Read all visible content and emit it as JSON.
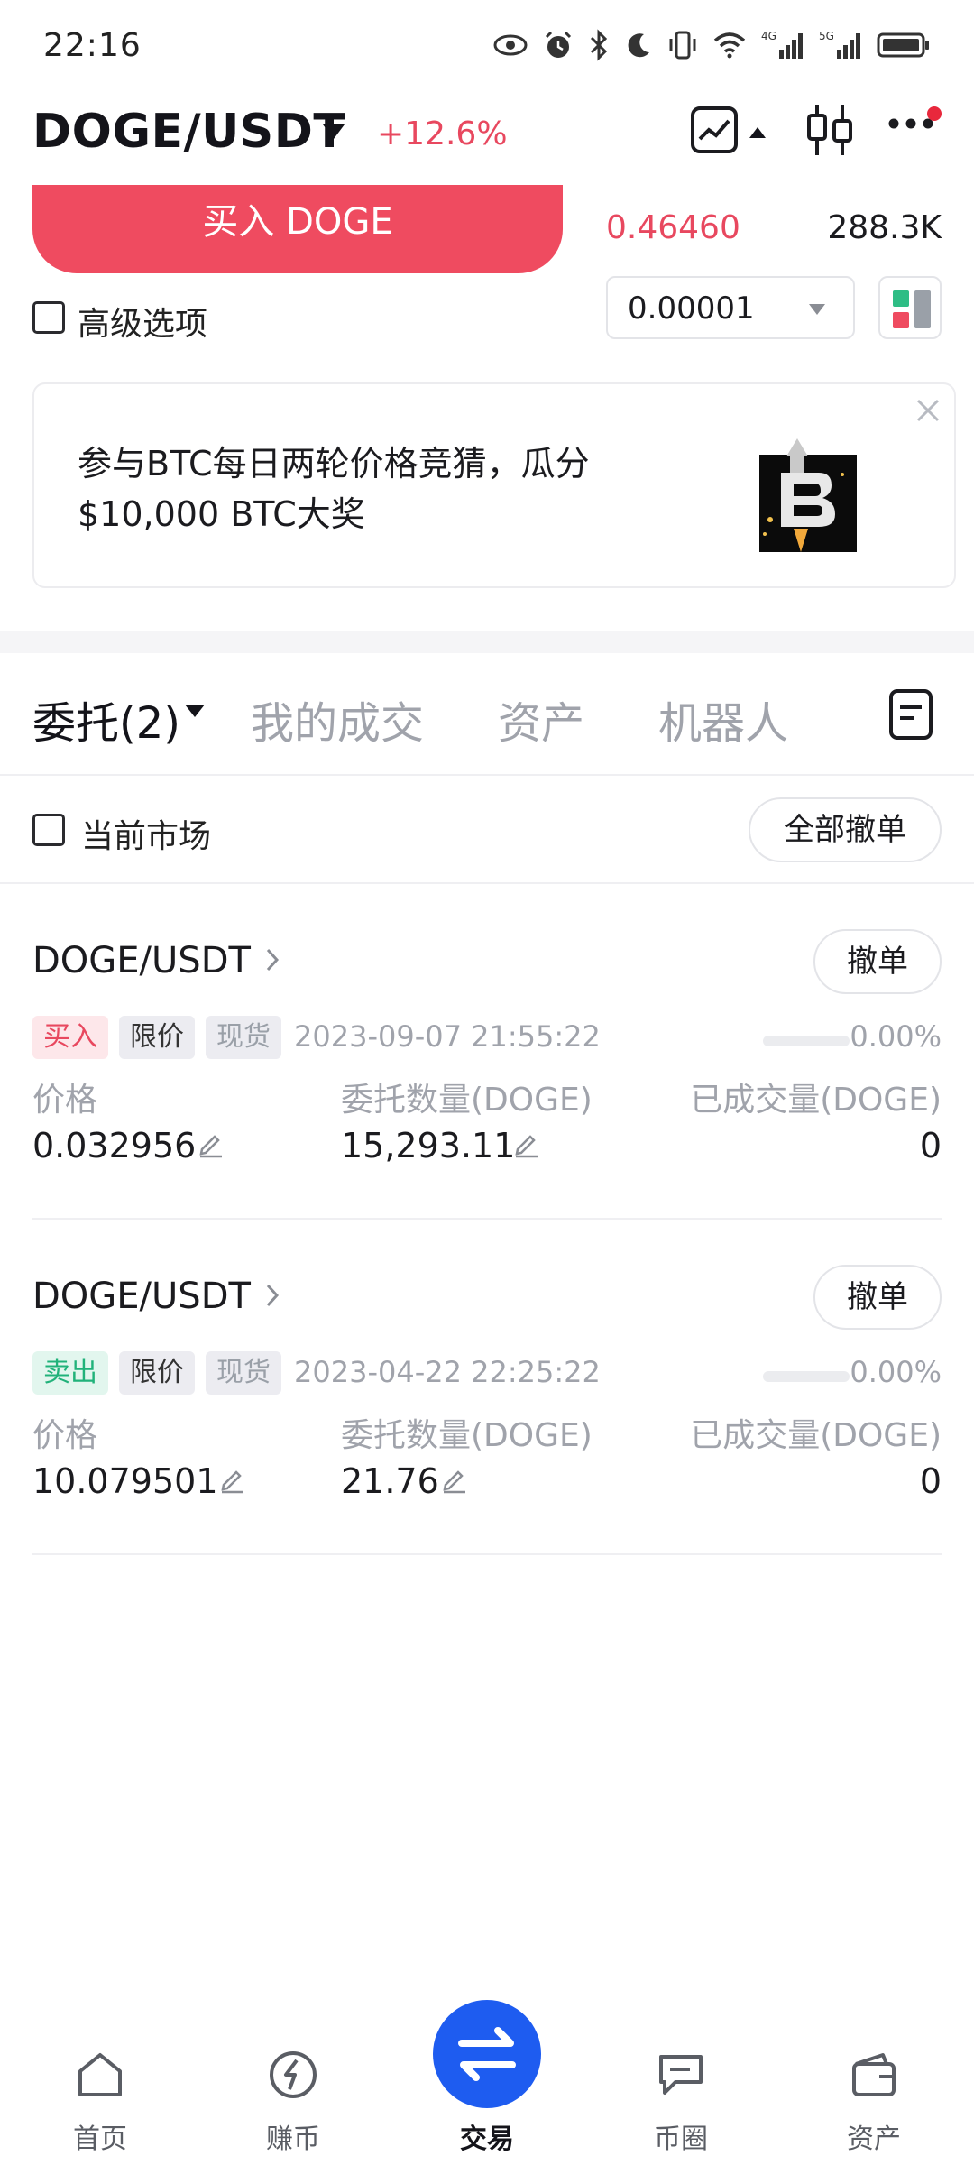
{
  "status_bar": {
    "time": "22:16",
    "icons": [
      "eye-icon",
      "alarm-icon",
      "bluetooth-icon",
      "moon-icon",
      "vibrate-icon",
      "wifi-icon",
      "signal-4g-icon",
      "signal-5g-icon",
      "battery-icon"
    ],
    "network_1": "4G",
    "network_2": "5G"
  },
  "header": {
    "pair": "DOGE/USDT",
    "change": "+12.6%",
    "change_color": "#e8485f"
  },
  "trade": {
    "buy_label": "买入 DOGE",
    "buy_color": "#ef4b60",
    "book_price": "0.46460",
    "book_qty": "288.3K",
    "advanced_options_label": "高级选项",
    "precision_value": "0.00001"
  },
  "banner": {
    "text_line1": "参与BTC每日两轮价格竞猜，瓜分",
    "text_line2": "$10,000 BTC大奖"
  },
  "tabs": [
    {
      "label": "委托(2)"
    },
    {
      "label": "我的成交"
    },
    {
      "label": "资产"
    },
    {
      "label": "机器人"
    }
  ],
  "filter": {
    "current_market_label": "当前市场",
    "cancel_all_label": "全部撤单"
  },
  "columns": {
    "price": "价格",
    "amount": "委托数量(DOGE)",
    "filled": "已成交量(DOGE)"
  },
  "orders": [
    {
      "pair": "DOGE/USDT",
      "cancel_label": "撤单",
      "side": "买入",
      "type": "限价",
      "kind": "现货",
      "time": "2023-09-07 21:55:22",
      "progress": "0.00%",
      "progress_fraction": 0,
      "price": "0.032956",
      "amount": "15,293.11",
      "filled": "0"
    },
    {
      "pair": "DOGE/USDT",
      "cancel_label": "撤单",
      "side": "卖出",
      "type": "限价",
      "kind": "现货",
      "time": "2023-04-22 22:25:22",
      "progress": "0.00%",
      "progress_fraction": 0,
      "price": "10.079501",
      "amount": "21.76",
      "filled": "0"
    }
  ],
  "bottom_nav": [
    {
      "label": "首页",
      "icon": "home-icon"
    },
    {
      "label": "赚币",
      "icon": "earn-icon"
    },
    {
      "label": "交易",
      "icon": "trade-swap-icon",
      "active": true
    },
    {
      "label": "币圈",
      "icon": "community-icon"
    },
    {
      "label": "资产",
      "icon": "wallet-icon"
    }
  ],
  "colors": {
    "accent_blue": "#1e5cf0",
    "buy_red": "#ef4b60",
    "sell_green": "#21b27a"
  }
}
